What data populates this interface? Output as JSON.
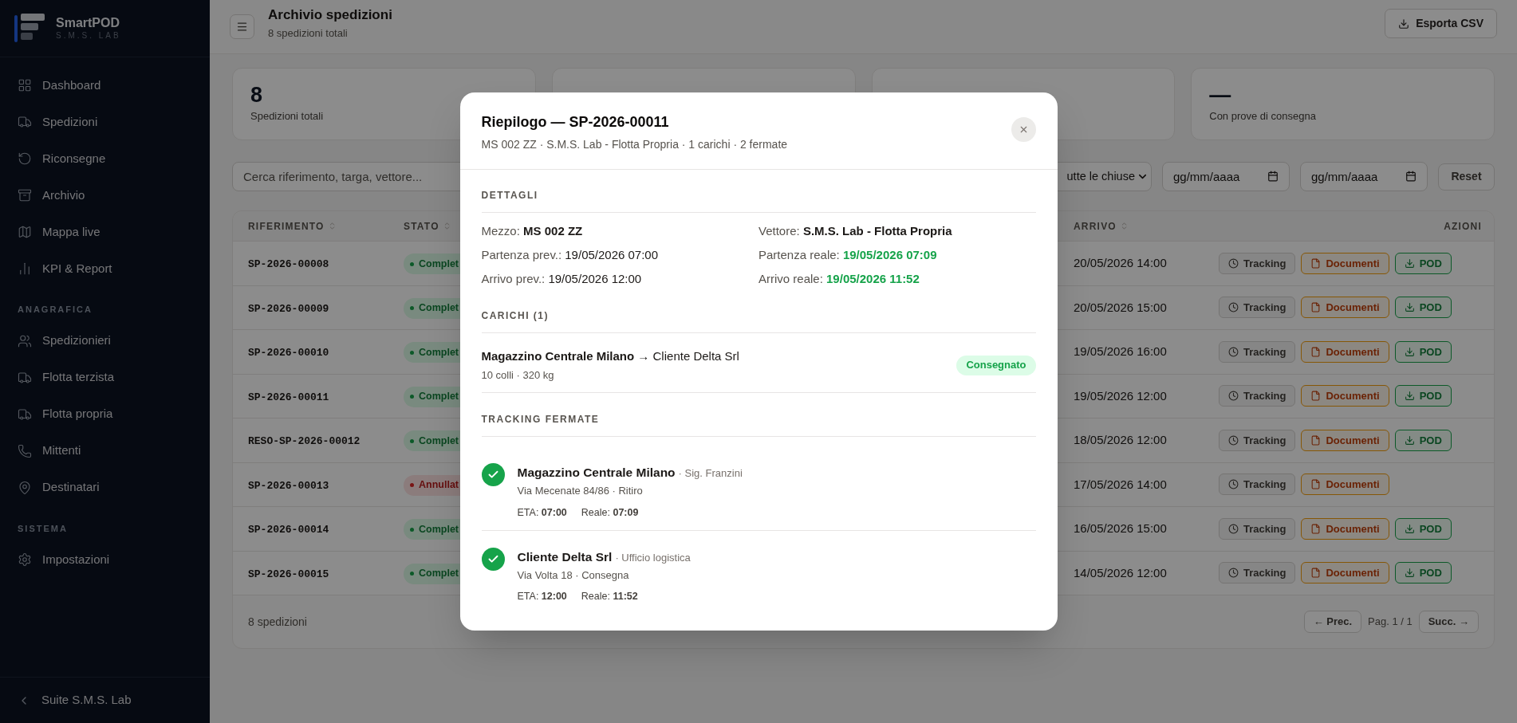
{
  "sidebar": {
    "brand": {
      "name": "SmartPOD",
      "sub": "S.M.S. LAB"
    },
    "sections": [
      {
        "items": [
          {
            "label": "Dashboard"
          },
          {
            "label": "Spedizioni"
          },
          {
            "label": "Riconsegne"
          },
          {
            "label": "Archivio"
          },
          {
            "label": "Mappa live"
          },
          {
            "label": "KPI & Report"
          }
        ]
      },
      {
        "heading": "ANAGRAFICA",
        "items": [
          {
            "label": "Spedizionieri"
          },
          {
            "label": "Flotta terzista"
          },
          {
            "label": "Flotta propria"
          },
          {
            "label": "Mittenti"
          },
          {
            "label": "Destinatari"
          }
        ]
      },
      {
        "heading": "SISTEMA",
        "items": [
          {
            "label": "Impostazioni"
          }
        ]
      }
    ],
    "footer": "Suite S.M.S. Lab"
  },
  "header": {
    "title": "Archivio spedizioni",
    "subtitle": "8 spedizioni totali",
    "export": "Esporta CSV"
  },
  "stats": [
    {
      "kind": "metric",
      "value": "8",
      "label": "Spedizioni totali"
    },
    {
      "kind": "covered"
    },
    {
      "kind": "covered"
    },
    {
      "kind": "metric",
      "value": "—",
      "label": "Con prove di consegna"
    }
  ],
  "filters": {
    "search": {
      "placeholder": "Cerca riferimento, targa, vettore..."
    },
    "select": {
      "value": "utte le chiuse"
    },
    "dates": [
      {
        "placeholder": "gg/mm/aaaa"
      },
      {
        "placeholder": "gg/mm/aaaa"
      }
    ],
    "reset": "Reset"
  },
  "table": {
    "columns": [
      {
        "label": "RIFERIMENTO",
        "sortable": true
      },
      {
        "label": "STATO",
        "sortable": true
      },
      {
        "label": "ARRIVO",
        "sortable": true
      },
      {
        "label": "AZIONI",
        "sortable": false
      }
    ],
    "rows": [
      {
        "ref": "SP-2026-00008",
        "status": {
          "label": "Complet",
          "kind": "ok"
        },
        "arrival": "20/05/2026 14:00",
        "actions": [
          {
            "kind": "tracking",
            "label": "Tracking"
          },
          {
            "kind": "docs",
            "label": "Documenti"
          },
          {
            "kind": "pod",
            "label": "POD"
          }
        ]
      },
      {
        "ref": "SP-2026-00009",
        "status": {
          "label": "Complet",
          "kind": "ok"
        },
        "arrival": "20/05/2026 15:00",
        "actions": [
          {
            "kind": "tracking",
            "label": "Tracking"
          },
          {
            "kind": "docs",
            "label": "Documenti"
          },
          {
            "kind": "pod",
            "label": "POD"
          }
        ]
      },
      {
        "ref": "SP-2026-00010",
        "status": {
          "label": "Complet",
          "kind": "ok"
        },
        "arrival": "19/05/2026 16:00",
        "actions": [
          {
            "kind": "tracking",
            "label": "Tracking"
          },
          {
            "kind": "docs",
            "label": "Documenti"
          },
          {
            "kind": "pod",
            "label": "POD"
          }
        ]
      },
      {
        "ref": "SP-2026-00011",
        "status": {
          "label": "Complet",
          "kind": "ok"
        },
        "arrival": "19/05/2026 12:00",
        "actions": [
          {
            "kind": "tracking",
            "label": "Tracking"
          },
          {
            "kind": "docs",
            "label": "Documenti"
          },
          {
            "kind": "pod",
            "label": "POD"
          }
        ]
      },
      {
        "ref": "RESO-SP-2026-00012",
        "status": {
          "label": "Complet",
          "kind": "ok"
        },
        "arrival": "18/05/2026 12:00",
        "actions": [
          {
            "kind": "tracking",
            "label": "Tracking"
          },
          {
            "kind": "docs",
            "label": "Documenti"
          },
          {
            "kind": "pod",
            "label": "POD"
          }
        ]
      },
      {
        "ref": "SP-2026-00013",
        "status": {
          "label": "Annullat",
          "kind": "cancelled"
        },
        "arrival": "17/05/2026 14:00",
        "actions": [
          {
            "kind": "tracking",
            "label": "Tracking"
          },
          {
            "kind": "docs",
            "label": "Documenti"
          }
        ]
      },
      {
        "ref": "SP-2026-00014",
        "status": {
          "label": "Complet",
          "kind": "ok"
        },
        "arrival": "16/05/2026 15:00",
        "actions": [
          {
            "kind": "tracking",
            "label": "Tracking"
          },
          {
            "kind": "docs",
            "label": "Documenti"
          },
          {
            "kind": "pod",
            "label": "POD"
          }
        ]
      },
      {
        "ref": "SP-2026-00015",
        "status": {
          "label": "Complet",
          "kind": "ok"
        },
        "arrival": "14/05/2026 12:00",
        "actions": [
          {
            "kind": "tracking",
            "label": "Tracking"
          },
          {
            "kind": "docs",
            "label": "Documenti"
          },
          {
            "kind": "pod",
            "label": "POD"
          }
        ]
      }
    ],
    "footer": "8 spedizioni",
    "pagination": {
      "prev": "← Prec.",
      "page": "Pag. 1 / 1",
      "next": "Succ. →"
    }
  },
  "modal": {
    "title": "Riepilogo — SP-2026-00011",
    "subtitle": "MS 002 ZZ · S.M.S. Lab - Flotta Propria · 1 carichi · 2 fermate",
    "details": {
      "heading": "DETTAGLI",
      "fields": [
        {
          "label": "Mezzo:",
          "value": "MS 002 ZZ",
          "kind": "strong"
        },
        {
          "label": "Vettore:",
          "value": "S.M.S. Lab - Flotta Propria",
          "kind": "strong"
        },
        {
          "label": "Partenza prev.:",
          "value": "19/05/2026 07:00",
          "kind": "plain"
        },
        {
          "label": "Partenza reale:",
          "value": "19/05/2026 07:09",
          "kind": "highlight"
        },
        {
          "label": "Arrivo prev.:",
          "value": "19/05/2026 12:00",
          "kind": "plain"
        },
        {
          "label": "Arrivo reale:",
          "value": "19/05/2026 11:52",
          "kind": "highlight"
        }
      ]
    },
    "loads": {
      "heading": "CARICHI (1)",
      "items": [
        {
          "route": "**Magazzino Centrale Milano** → Cliente Delta Srl",
          "meta": "10 colli · 320 kg",
          "status": "Consegnato"
        }
      ]
    },
    "stops": {
      "heading": "TRACKING FERMATE",
      "items": [
        {
          "name": "Magazzino Centrale Milano",
          "contact": "· Sig. Franzini",
          "address": "Via Mecenate 84/86 · Ritiro",
          "eta": "ETA: **07:00**",
          "real": "Reale: **07:09**",
          "done": true
        },
        {
          "name": "Cliente Delta Srl",
          "contact": "· Ufficio logistica",
          "address": "Via Volta 18 · Consegna",
          "eta": "ETA: **12:00**",
          "real": "Reale: **11:52**",
          "done": true
        }
      ]
    }
  }
}
